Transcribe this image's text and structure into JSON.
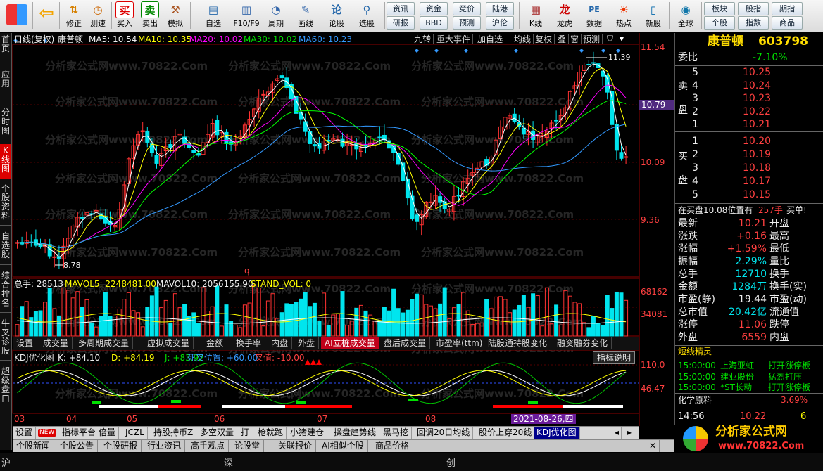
{
  "toolbar": {
    "buttons": [
      {
        "name": "back-button",
        "label": "",
        "icon": "back-arrow-icon"
      },
      {
        "name": "fix-button",
        "label": "修正",
        "icon": "up-down-icon"
      },
      {
        "name": "backtest-button",
        "label": "测速",
        "icon": "clock-icon"
      },
      {
        "name": "buy-button",
        "label": "买入",
        "icon": "buy-icon"
      },
      {
        "name": "sell-button",
        "label": "卖出",
        "icon": "sell-icon"
      },
      {
        "name": "simulate-button",
        "label": "模拟",
        "icon": "hammer-icon"
      },
      {
        "name": "watchlist-button",
        "label": "自选",
        "icon": "folder-icon"
      },
      {
        "name": "f10-button",
        "label": "F10/F9",
        "icon": "doc-icon"
      },
      {
        "name": "period-button",
        "label": "周期",
        "icon": "period-icon"
      },
      {
        "name": "draw-button",
        "label": "画线",
        "icon": "pencil-icon"
      },
      {
        "name": "forum-button",
        "label": "论股",
        "icon": "forum-icon"
      },
      {
        "name": "select-stock-button",
        "label": "选股",
        "icon": "magnifier-icon"
      }
    ],
    "mid_buttons": [
      [
        "资讯",
        "资金",
        "竞价",
        "陆港"
      ],
      [
        "研报",
        "BBD",
        "预测",
        "沪伦"
      ]
    ],
    "buttons2": [
      {
        "name": "kline-button",
        "label": "K线",
        "icon": "kline-icon"
      },
      {
        "name": "dragon-button",
        "label": "龙虎",
        "icon": "dragon-icon"
      },
      {
        "name": "data-button",
        "label": "数据",
        "icon": "pe-icon"
      },
      {
        "name": "hot-button",
        "label": "热点",
        "icon": "hot-icon"
      },
      {
        "name": "newstock-button",
        "label": "新股",
        "icon": "newstock-icon"
      },
      {
        "name": "global-button",
        "label": "全球",
        "icon": "globe-icon"
      }
    ],
    "right_buttons": [
      [
        "板块",
        "股指",
        "期指"
      ],
      [
        "个股",
        "指数",
        "商品"
      ]
    ]
  },
  "left_tabs": [
    "首页",
    "应用",
    "分时图",
    "K线图",
    "个股资料",
    "自选股",
    "综合排名",
    "牛叉诊股",
    "超级盘口"
  ],
  "chart_header": {
    "period": "日线(复权)",
    "stock": "康普顿",
    "ma5": "MA5: 10.54",
    "ma10": "MA10: 10.35",
    "ma20": "MA20: 10.02",
    "ma30": "MA30: 10.02",
    "ma60": "MA60: 10.23"
  },
  "chart_buttons": [
    "九转",
    "重大事件",
    "加自选",
    "均线",
    "复权",
    "叠",
    "窗",
    "预测"
  ],
  "price_axis": {
    "top": "11.54",
    "mid": "10.09",
    "low": "9.36",
    "cur": "10.79"
  },
  "annotations": {
    "high": "11.39",
    "low": "8.78",
    "q": "q"
  },
  "watermark": "分析家公式网www.70822.Com",
  "volume": {
    "label1": "总手: 28513",
    "label2": "MAVOL5: 2248481.00",
    "label3": "MAVOL10: 2056155.90",
    "label4": "STAND_VOL: 0",
    "axis_top": "68162",
    "axis_mid": "34081"
  },
  "chart_tabs": [
    "设置",
    "成交量",
    "多周期成交量",
    "虚拟成交量",
    "金额",
    "换手率",
    "内盘",
    "外盘",
    "AI立桩成交量",
    "盘后成交量",
    "市盈率(ttm)",
    "陆股通持股变化",
    "融资融券变化"
  ],
  "kdj": {
    "title": "KDJ优化图",
    "k": "K: +84.10",
    "d": "D: +84.19",
    "j": "J: +83.92",
    "dead": "死叉位置: +60.00",
    "cross": "叉值: -10.00",
    "explain": "指标说明",
    "axis1": "110.0",
    "axis2": "46.47"
  },
  "months": [
    "03",
    "04",
    "05",
    "06",
    "07",
    "08"
  ],
  "date_box": "2021-08-26,四",
  "bottom_tabs": [
    "设置",
    "NEW",
    "指标平台",
    "倍量",
    "JCZL",
    "持股持币Z",
    "多空双量",
    "打一枪就跑",
    "小猪建仓",
    "操盘趋势线",
    "黑马挖",
    "回调20日均线",
    "股价上穿20线",
    "KDJ优化图"
  ],
  "bottom_tabs2": [
    "个股新闻",
    "个股公告",
    "个股研报",
    "行业资讯",
    "高手观点",
    "论股堂",
    "关联报价",
    "AI相似个股",
    "商品价格"
  ],
  "status": [
    "沪",
    "深",
    "创"
  ],
  "right": {
    "title": "康普顿",
    "code": "603798",
    "wb_label": "委比",
    "wb": "-7.10%",
    "sell_label1": "卖",
    "sell_label2": "盘",
    "buy_label1": "买",
    "buy_label2": "盘",
    "asks": [
      {
        "n": "5",
        "p": "10.25"
      },
      {
        "n": "4",
        "p": "10.24"
      },
      {
        "n": "3",
        "p": "10.23"
      },
      {
        "n": "2",
        "p": "10.22"
      },
      {
        "n": "1",
        "p": "10.21"
      }
    ],
    "bids": [
      {
        "n": "1",
        "p": "10.20"
      },
      {
        "n": "2",
        "p": "10.19"
      },
      {
        "n": "3",
        "p": "10.18"
      },
      {
        "n": "4",
        "p": "10.17"
      },
      {
        "n": "5",
        "p": "10.15"
      }
    ],
    "note1": "在买盘10.08位置有",
    "note2": "257手",
    "note3": "买单!",
    "stats": [
      {
        "k": "最新",
        "v": "10.21",
        "c": "red",
        "k2": "开盘"
      },
      {
        "k": "涨跌",
        "v": "+0.16",
        "c": "red",
        "k2": "最高"
      },
      {
        "k": "涨幅",
        "v": "+1.59%",
        "c": "red",
        "k2": "最低"
      },
      {
        "k": "振幅",
        "v": "2.29%",
        "c": "cyn",
        "k2": "量比"
      },
      {
        "k": "总手",
        "v": "12710",
        "c": "cyn",
        "k2": "换手"
      },
      {
        "k": "金额",
        "v": "1284万",
        "c": "cyn",
        "k2": "换手(实)"
      },
      {
        "k": "市盈(静)",
        "v": "19.44",
        "c": "wht",
        "k2": "市盈(动)"
      },
      {
        "k": "总市值",
        "v": "20.42亿",
        "c": "cyn",
        "k2": "流通值"
      },
      {
        "k": "涨停",
        "v": "11.06",
        "c": "red",
        "k2": "跌停"
      },
      {
        "k": "外盘",
        "v": "6559",
        "c": "red",
        "k2": "内盘"
      }
    ],
    "sprite_title": "短线精灵",
    "sprites": [
      {
        "t": "15:00:00",
        "n": "上海亚虹",
        "e": "打开涨停板"
      },
      {
        "t": "15:00:00",
        "n": "建业股份",
        "e": "猛烈打压"
      },
      {
        "t": "15:00:00",
        "n": "*ST长动",
        "e": "打开涨停板"
      }
    ],
    "sector": "化学原料",
    "sector_pct": "3.69%",
    "tick_time": "14:56",
    "tick_price": "10.22",
    "tick_vol": "6"
  },
  "logo": {
    "line1": "分析家公式网",
    "line2": "www.70822.Com"
  },
  "colors": {
    "up": "#ff3232",
    "down": "#00e5ee",
    "ma5": "#ffffff",
    "ma10": "#ffff00",
    "ma20": "#ff00ff",
    "ma30": "#00ff00",
    "ma60": "#3399ff"
  }
}
